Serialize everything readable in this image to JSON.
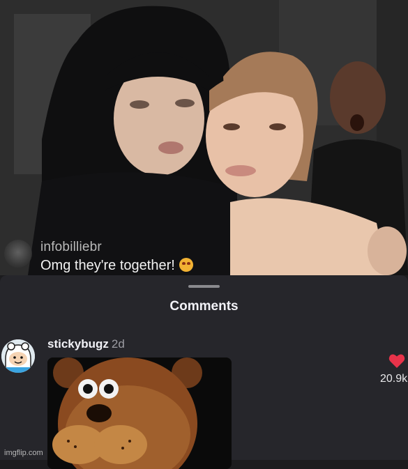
{
  "story": {
    "username": "infobilliebr",
    "caption": "Omg they're together!",
    "caption_emoji": "smiling-face-with-heart-eyes-icon"
  },
  "comments_sheet": {
    "title": "Comments",
    "comment": {
      "username": "stickybugz",
      "age": "2d",
      "likes": "20.9k",
      "like_icon": "heart-icon",
      "like_color": "#e8334a"
    }
  },
  "watermark": "imgflip.com"
}
